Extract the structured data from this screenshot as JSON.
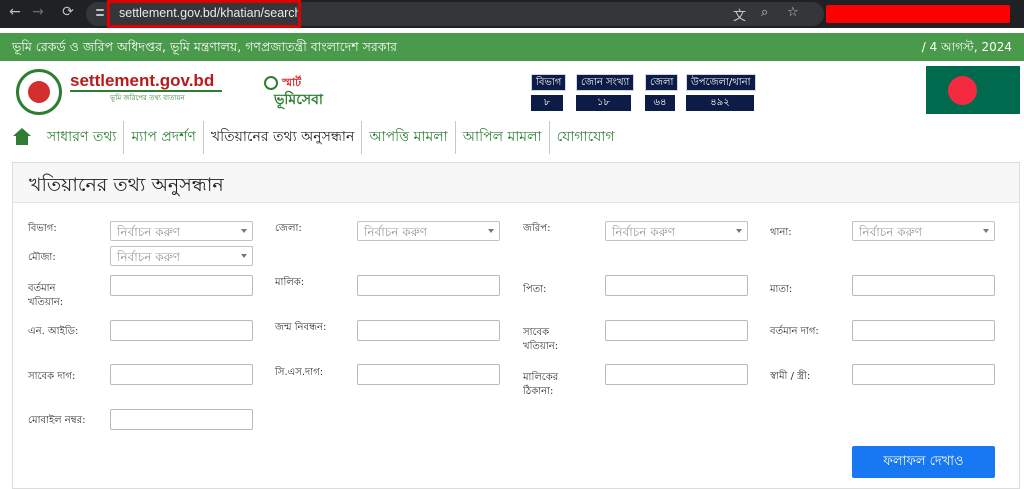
{
  "browser": {
    "url": "settlement.gov.bd/khatian/search",
    "back_icon": "←",
    "forward_icon": "→",
    "reload_icon": "⟳",
    "translate_icon": "文",
    "zoom_icon": "⌕",
    "star_icon": "☆"
  },
  "header": {
    "title": "ভূমি রেকর্ড ও জরিপ অধিদপ্তর, ভূমি মন্ত্রণালয়, গণপ্রজাতন্ত্রী বাংলাদেশ সরকার",
    "date": "/ 4 আগস্ট, 2024",
    "site_name": "settlement.gov.bd",
    "site_tagline": "ভূমি জরিপের তথ্য বাতায়ন",
    "smart_logo_top": "স্মার্ট",
    "smart_logo_bottom": "ভূমিসেবা",
    "stats": [
      {
        "label": "বিভাগ",
        "value": "৮"
      },
      {
        "label": "জোন সংখ্যা",
        "value": "১৮"
      },
      {
        "label": "জেলা",
        "value": "৬৪"
      },
      {
        "label": "উপজেলা/থানা",
        "value": "৪৯২"
      }
    ],
    "flag_colors": {
      "field": "#006a4e",
      "disc": "#f42a41"
    }
  },
  "menu": {
    "items": [
      {
        "label": "সাধারণ তথ্য"
      },
      {
        "label": "ম্যাপ প্রদর্শণ"
      },
      {
        "label": "খতিয়ানের তথ্য অনুসন্ধান"
      },
      {
        "label": "আপত্তি মামলা"
      },
      {
        "label": "আপিল মামলা"
      },
      {
        "label": "যোগাযোগ"
      }
    ]
  },
  "panel": {
    "title": "খতিয়ানের তথ্য অনুসন্ধান"
  },
  "form": {
    "select_placeholder": "নির্বাচন করুণ",
    "labels": {
      "division": "বিভাগ:",
      "district": "জেলা:",
      "survey": "জরিপ:",
      "thana": "থানা:",
      "mouza": "মৌজা:",
      "current_khatian_1": "বর্তমান",
      "current_khatian_2": "খতিয়ান:",
      "owner": "মালিক:",
      "father": "পিতা:",
      "mother": "মাতা:",
      "nid": "এন. আইডি:",
      "birth_reg": "জন্ম নিবন্ধন:",
      "old_khatian_1": "সাবেক",
      "old_khatian_2": "খতিয়ান:",
      "current_dag": "বর্তমান দাগ:",
      "old_dag": "সাবেক দাগ:",
      "cs_dag": "সি.এস.দাগ:",
      "owner_address_1": "মালিকের",
      "owner_address_2": "ঠিকানা:",
      "spouse": "স্বামী / স্ত্রী:",
      "mobile": "মোবাইল নম্বর:"
    },
    "submit_label": "ফলাফল দেখাও"
  },
  "colors": {
    "header_green": "#4a9a4c",
    "menu_green": "#2e7d32",
    "stat_navy": "#0d1b47",
    "button_blue": "#1877f2",
    "url_highlight": "#e00000"
  }
}
